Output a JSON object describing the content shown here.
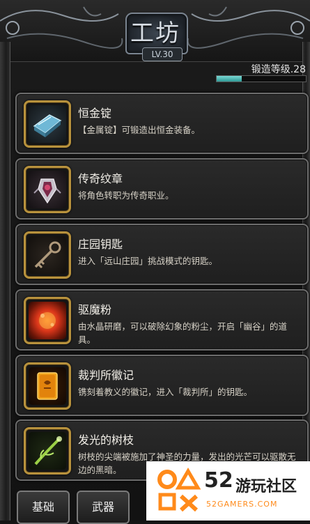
{
  "header": {
    "title": "工坊",
    "level": "LV.30"
  },
  "forge": {
    "label": "锻造等级.28",
    "progress": 0.28,
    "fill_color": "#4fc1bc"
  },
  "items": [
    {
      "name": "恒金锭",
      "desc": "【金属锭】可锻造出恒金装备。",
      "icon": "metal-ingot-icon"
    },
    {
      "name": "传奇纹章",
      "desc": "将角色转职为传奇职业。",
      "icon": "legend-emblem-icon"
    },
    {
      "name": "庄园钥匙",
      "desc": "进入「远山庄园」挑战模式的钥匙。",
      "icon": "key-icon"
    },
    {
      "name": "驱魔粉",
      "desc": "由水晶研磨，可以破除幻象的粉尘，开启「幽谷」的道具。",
      "icon": "exorcism-powder-icon"
    },
    {
      "name": "裁判所徽记",
      "desc": "镌刻着教义的徽记，进入「裁判所」的钥匙。",
      "icon": "tribunal-badge-icon"
    },
    {
      "name": "发光的树枝",
      "desc": "树枝的尖端被施加了神圣的力量，发出的光芒可以驱散无边的黑暗。",
      "icon": "glowing-branch-icon"
    }
  ],
  "tabs": [
    {
      "label": "基础"
    },
    {
      "label": "武器"
    }
  ],
  "watermark": {
    "number": "52",
    "text": "游玩社区",
    "url": "52GAMERS.COM"
  }
}
